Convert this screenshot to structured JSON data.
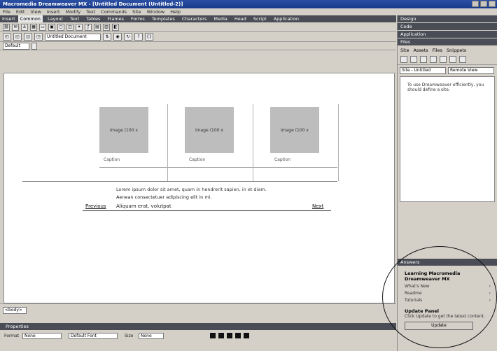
{
  "window": {
    "title": "Macromedia Dreamweaver MX - [Untitled Document (Untitled-2)]"
  },
  "menu": [
    "File",
    "Edit",
    "View",
    "Insert",
    "Modify",
    "Text",
    "Commands",
    "Site",
    "Window",
    "Help"
  ],
  "insert_bar": {
    "title": "Insert",
    "tabs": [
      "Common",
      "Layout",
      "Text",
      "Tables",
      "Frames",
      "Forms",
      "Templates",
      "Characters",
      "Media",
      "Head",
      "Script",
      "Application"
    ]
  },
  "doc_toolbar": {
    "title_value": "Untitled Document"
  },
  "view_bar": {
    "view_select": "Default"
  },
  "page": {
    "image_placeholder": "Image (100 x",
    "captions": [
      "Caption",
      "Caption",
      "Caption"
    ],
    "text_line1": "Lorem ipsum dolor sit amet, quam in hendrerit sapien, in et diam.",
    "text_line2": "Aenean consectetuer adipiscing elit in mi.",
    "nav_prev": "Previous",
    "nav_mid": "Aliquam erat, volutpat",
    "nav_next": "Next"
  },
  "status": {
    "tag": "<body>"
  },
  "properties": {
    "title": "Properties",
    "format_label": "Format",
    "format_value": "None",
    "font_value": "Default Font",
    "size_label": "Size",
    "size_value": "None"
  },
  "right_panel": {
    "design_title": "Design",
    "code_title": "Code",
    "application_title": "Application",
    "files_title": "Files",
    "tabs": [
      "Site",
      "Assets",
      "Files",
      "Snippets"
    ],
    "site_select": "Site - Untitled",
    "view_select": "Remote View",
    "files_text": "To use Dreamweaver efficiently, you should define a site.",
    "answers": {
      "title": "Answers",
      "heading": "Learning Macromedia Dreamweaver MX",
      "rows": [
        {
          "label": "What's New"
        },
        {
          "label": "Readme"
        },
        {
          "label": "Tutorials"
        }
      ],
      "update_title": "Update Panel",
      "update_text": "Click Update to get the latest content.",
      "update_button": "Update"
    }
  }
}
